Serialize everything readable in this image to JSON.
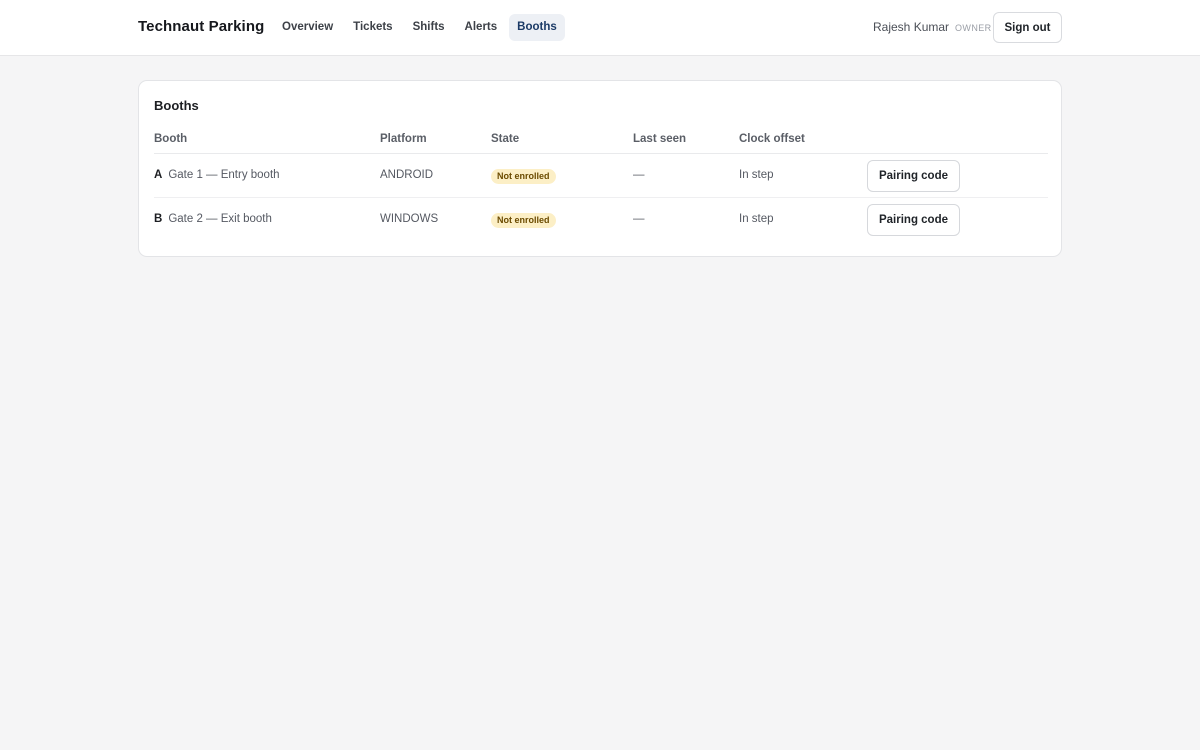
{
  "app": {
    "brand": "Technaut Parking",
    "nav": [
      "Overview",
      "Tickets",
      "Shifts",
      "Alerts",
      "Booths"
    ],
    "active_nav": "Booths",
    "user_name": "Rajesh Kumar",
    "user_role": "OWNER",
    "signout_label": "Sign out"
  },
  "booths": {
    "title": "Booths",
    "columns": [
      "Booth",
      "Platform",
      "State",
      "Last seen",
      "Clock offset"
    ],
    "rows": [
      {
        "code": "A",
        "name": "Gate 1 — Entry booth",
        "platform": "ANDROID",
        "state": "Not enrolled",
        "last_seen": "—",
        "clock_offset": "In step",
        "action": "Pairing code"
      },
      {
        "code": "B",
        "name": "Gate 2 — Exit booth",
        "platform": "WINDOWS",
        "state": "Not enrolled",
        "last_seen": "—",
        "clock_offset": "In step",
        "action": "Pairing code"
      }
    ]
  },
  "colors": {
    "accent_nav_bg": "#edf0f5",
    "badge_bg": "#fcefc6",
    "badge_text": "#6b4b00"
  }
}
